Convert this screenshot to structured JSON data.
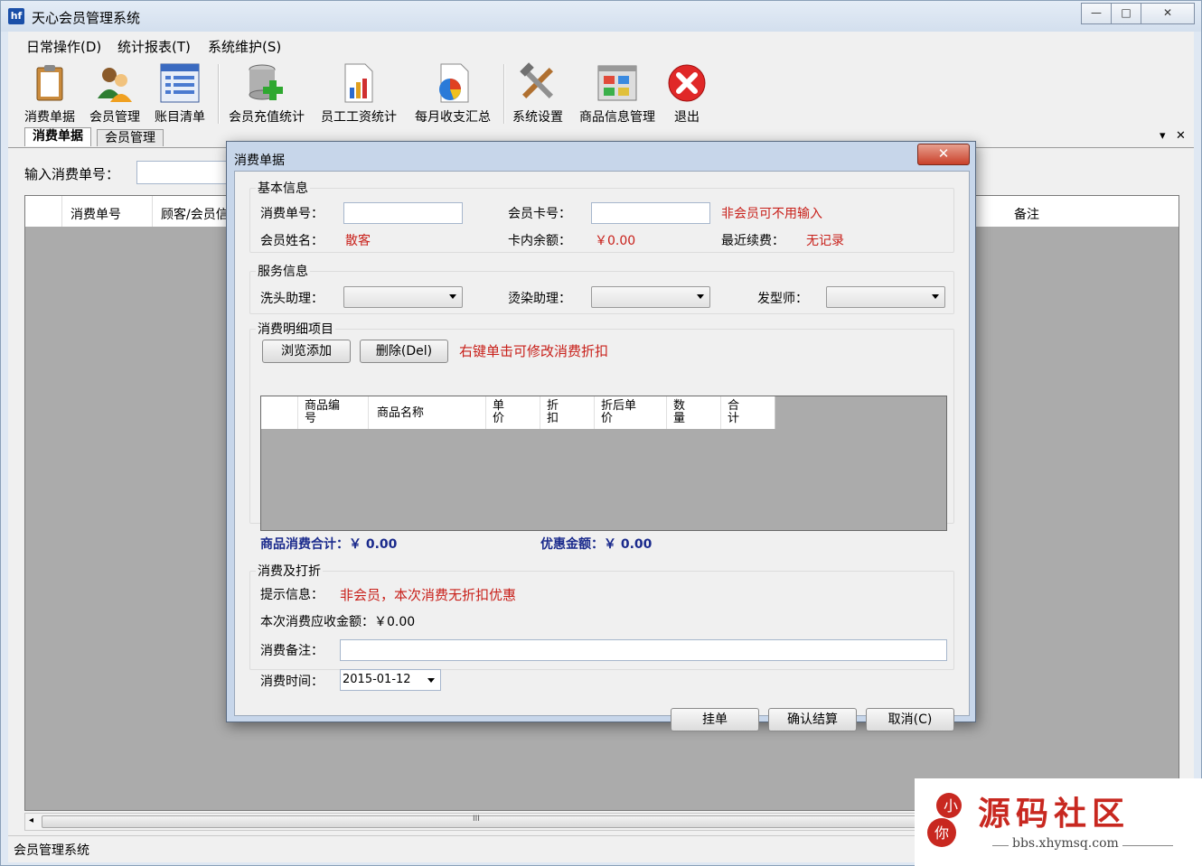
{
  "window": {
    "title": "天心会员管理系统",
    "logo_text": "hf",
    "minimize": "—",
    "maximize": "□",
    "close": "✕"
  },
  "menu": {
    "items": [
      "日常操作(D)",
      "统计报表(T)",
      "系统维护(S)"
    ]
  },
  "toolbar": {
    "items": [
      {
        "label": "消费单据",
        "icon": "clipboard-icon"
      },
      {
        "label": "会员管理",
        "icon": "users-icon"
      },
      {
        "label": "账目清单",
        "icon": "list-icon"
      },
      {
        "label": "会员充值统计",
        "icon": "database-add-icon"
      },
      {
        "label": "员工工资统计",
        "icon": "bar-chart-icon"
      },
      {
        "label": "每月收支汇总",
        "icon": "pie-chart-icon"
      },
      {
        "label": "系统设置",
        "icon": "tools-icon"
      },
      {
        "label": "商品信息管理",
        "icon": "product-window-icon"
      },
      {
        "label": "退出",
        "icon": "exit-x-icon"
      }
    ]
  },
  "tabs": [
    {
      "label": "消费单据",
      "active": true
    },
    {
      "label": "会员管理",
      "active": false
    }
  ],
  "tab_controls": {
    "dropdown": "▾",
    "close": "✕"
  },
  "main": {
    "search_label": "输入消费单号：",
    "grid_headers": [
      "消费单号",
      "顾客/会员信",
      "备注"
    ],
    "status": "会员管理系统",
    "scroll_grip": "III"
  },
  "dialog": {
    "title": "消费单据",
    "close": "✕",
    "basic": {
      "legend": "基本信息",
      "order_no_label": "消费单号：",
      "card_no_label": "会员卡号：",
      "non_member_hint": "非会员可不用输入",
      "name_label": "会员姓名：",
      "name_value": "散客",
      "balance_label": "卡内余额：",
      "balance_value": "￥0.00",
      "last_fee_label": "最近续费：",
      "last_fee_value": "无记录"
    },
    "service": {
      "legend": "服务信息",
      "wash_label": "洗头助理：",
      "dye_label": "烫染助理：",
      "stylist_label": "发型师："
    },
    "detail": {
      "legend": "消费明细项目",
      "browse_button": "浏览添加",
      "delete_button": "删除(Del)",
      "hint": "右键单击可修改消费折扣",
      "columns": [
        "商品编\n号",
        "商品名称",
        "单\n价",
        "折\n扣",
        "折后单\n价",
        "数\n量",
        "合\n计"
      ],
      "total_label": "商品消费合计：￥  0.00",
      "discount_label": "优惠金额：￥  0.00"
    },
    "settle": {
      "legend": "消费及打折",
      "tip_label": "提示信息：",
      "tip_value": "非会员，本次消费无折扣优惠",
      "amount_label": "本次消费应收金额：￥0.00",
      "remark_label": "消费备注：",
      "time_label": "消费时间：",
      "time_value": "2015-01-12"
    },
    "buttons": {
      "hold": "挂单",
      "confirm": "确认结算",
      "cancel": "取消(C)"
    }
  },
  "watermark": {
    "logo_chars": "小你",
    "title": "源码社区",
    "url": "bbs.xhymsq.com"
  },
  "colors": {
    "accent_red": "#c8201a",
    "total_blue": "#1a2a8c",
    "grid_gray": "#ababab"
  }
}
